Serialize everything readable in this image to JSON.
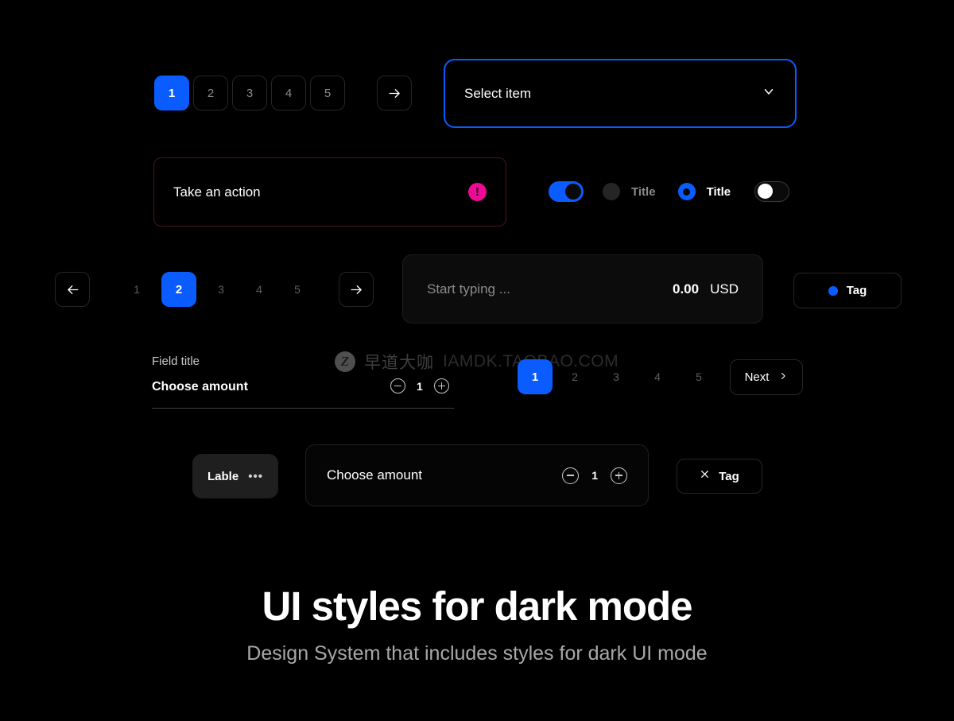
{
  "top_pagination": {
    "pages": [
      {
        "label": "1",
        "active": true
      },
      {
        "label": "2",
        "active": false
      },
      {
        "label": "3",
        "active": false
      },
      {
        "label": "4",
        "active": false
      },
      {
        "label": "5",
        "active": false
      }
    ],
    "next_arrow": "→"
  },
  "select": {
    "value": "Select item",
    "chevron": "⌄"
  },
  "alert": {
    "text": "Take an action",
    "icon_glyph": "!",
    "border_color": "#4a1030",
    "icon_color": "#ef0a96"
  },
  "controls": {
    "toggle_on_state": "on",
    "radio_unselected_label": "Title",
    "radio_selected_label": "Title",
    "toggle_off_state": "off"
  },
  "mid_pagination": {
    "prev_arrow": "←",
    "next_arrow": "→",
    "pages": [
      {
        "label": "1",
        "active": false
      },
      {
        "label": "2",
        "active": true
      },
      {
        "label": "3",
        "active": false
      },
      {
        "label": "4",
        "active": false
      },
      {
        "label": "5",
        "active": false
      }
    ]
  },
  "typing_field": {
    "placeholder": "Start typing ...",
    "amount": "0.00",
    "currency": "USD"
  },
  "tag_dot_button": {
    "label": "Tag"
  },
  "field": {
    "title": "Field title",
    "label": "Choose amount",
    "stepper_value": "1",
    "minus_glyph": "−",
    "plus_glyph": "+"
  },
  "watermark": {
    "logo_letter": "Z",
    "chinese": "早道大咖",
    "english": "IAMDK.TAOBAO.COM"
  },
  "bottom_pagination": {
    "pages": [
      {
        "label": "1",
        "active": true
      },
      {
        "label": "2",
        "active": false
      },
      {
        "label": "3",
        "active": false
      },
      {
        "label": "4",
        "active": false
      },
      {
        "label": "5",
        "active": false
      }
    ],
    "next_button_label": "Next",
    "next_button_chevron": "›"
  },
  "lable_chip": {
    "label": "Lable",
    "menu_glyph": "•••"
  },
  "amount_card": {
    "label": "Choose amount",
    "stepper_value": "1"
  },
  "tag_close_button": {
    "close_glyph": "✕",
    "label": "Tag"
  },
  "footer": {
    "headline": "UI styles for dark mode",
    "subhead": "Design System that includes styles for dark UI mode"
  },
  "theme": {
    "accent_blue": "#0a5cff",
    "accent_pink": "#ef0a96",
    "background": "#000000"
  }
}
